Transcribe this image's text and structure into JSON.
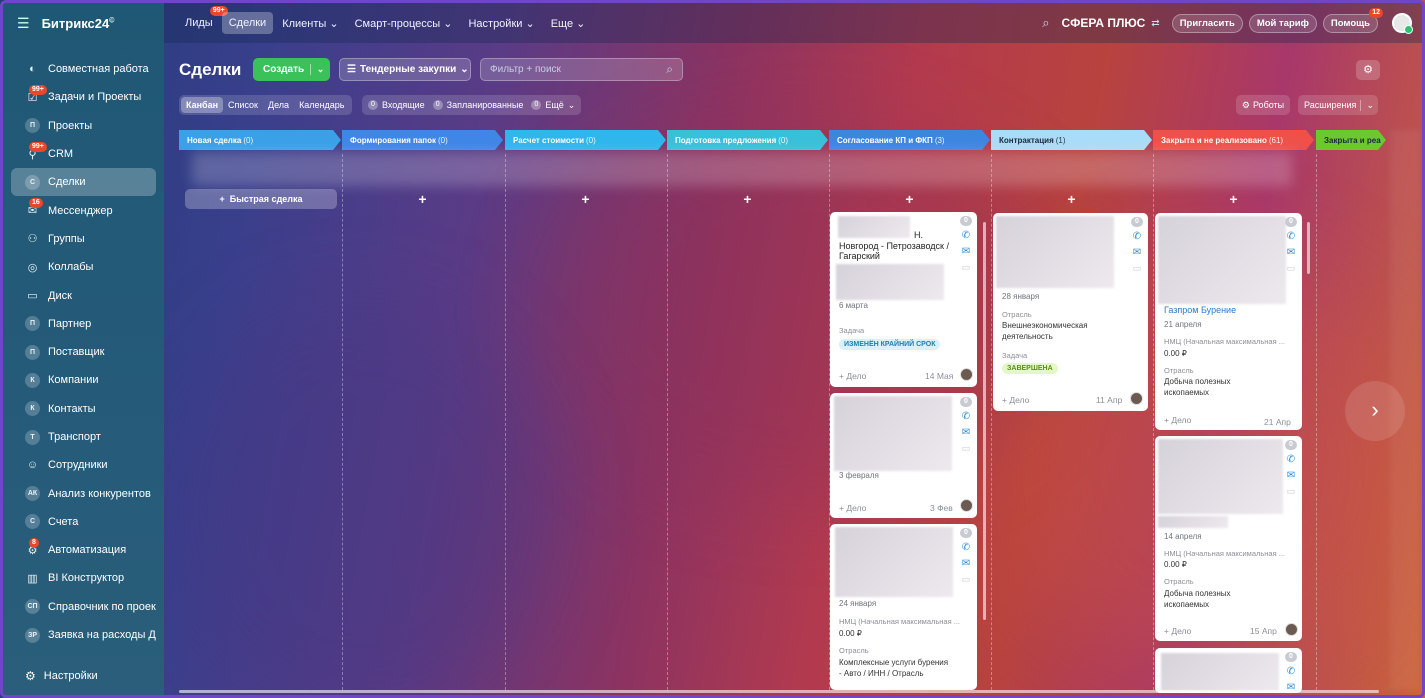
{
  "app": {
    "logo": "Битрикс24",
    "logo_mark": "©"
  },
  "sidebar": {
    "items": [
      {
        "label": "Совместная работа",
        "icon": "collab-icon",
        "badge": "",
        "chev": "⌄"
      },
      {
        "label": "Задачи и Проекты",
        "icon": "tasks-icon",
        "badge": "99+"
      },
      {
        "label": "Проекты",
        "icon": "П",
        "badge": ""
      },
      {
        "label": "CRM",
        "icon": "crm-icon",
        "badge": "99+"
      },
      {
        "label": "Сделки",
        "icon": "С",
        "badge": "",
        "active": true
      },
      {
        "label": "Мессенджер",
        "icon": "messenger-icon",
        "badge": "16"
      },
      {
        "label": "Группы",
        "icon": "groups-icon",
        "badge": ""
      },
      {
        "label": "Коллабы",
        "icon": "collabs-icon",
        "badge": ""
      },
      {
        "label": "Диск",
        "icon": "disk-icon",
        "badge": ""
      },
      {
        "label": "Партнер",
        "icon": "П",
        "badge": ""
      },
      {
        "label": "Поставщик",
        "icon": "П",
        "badge": ""
      },
      {
        "label": "Компании",
        "icon": "К",
        "badge": ""
      },
      {
        "label": "Контакты",
        "icon": "К",
        "badge": ""
      },
      {
        "label": "Транспорт",
        "icon": "Т",
        "badge": ""
      },
      {
        "label": "Сотрудники",
        "icon": "employees-icon",
        "badge": ""
      },
      {
        "label": "Анализ конкурентов",
        "icon": "АК",
        "badge": ""
      },
      {
        "label": "Счета",
        "icon": "С",
        "badge": ""
      },
      {
        "label": "Автоматизация",
        "icon": "automation-icon",
        "badge": "8"
      },
      {
        "label": "BI Конструктор",
        "icon": "bi-icon",
        "badge": ""
      },
      {
        "label": "Справочник по проек...",
        "icon": "СП",
        "badge": ""
      },
      {
        "label": "Заявка на расходы Дл...",
        "icon": "ЗР",
        "badge": ""
      }
    ],
    "settings": "Настройки"
  },
  "topnav": {
    "items": [
      {
        "label": "Лиды",
        "badge": "99+"
      },
      {
        "label": "Сделки",
        "active": true
      },
      {
        "label": "Клиенты ⌄"
      },
      {
        "label": "Смарт-процессы ⌄"
      },
      {
        "label": "Настройки ⌄"
      },
      {
        "label": "Еще ⌄"
      }
    ],
    "company": "СФЕРА ПЛЮС",
    "invite": "Пригласить",
    "tariff": "Мой тариф",
    "help": "Помощь",
    "help_badge": "12"
  },
  "toolbar": {
    "title": "Сделки",
    "create": "Создать",
    "tender": "Тендерные закупки",
    "filter_placeholder": "Фильтр + поиск"
  },
  "views": {
    "items": [
      "Канбан",
      "Список",
      "Дела",
      "Календарь"
    ],
    "active": 0
  },
  "counters": [
    {
      "n": "0",
      "label": "Входящие"
    },
    {
      "n": "0",
      "label": "Запланированные"
    },
    {
      "n": "0",
      "label": "Ещё"
    }
  ],
  "robots": "Роботы",
  "extensions": "Расширения",
  "stages": [
    {
      "name": "Новая сделка",
      "count": "(0)",
      "color": "#3aa0e8"
    },
    {
      "name": "Формирования папок",
      "count": "(0)",
      "color": "#3f86e6"
    },
    {
      "name": "Расчет стоимости",
      "count": "(0)",
      "color": "#2fb6ec"
    },
    {
      "name": "Подготовка предложения",
      "count": "(0)",
      "color": "#38c0d8"
    },
    {
      "name": "Согласование КП и ФКП",
      "count": "(3)",
      "color": "#3d86e0"
    },
    {
      "name": "Контрактация",
      "count": "(1)",
      "color": "#a9dcf6",
      "dark": true
    },
    {
      "name": "Закрыта и не реализовано",
      "count": "(61)",
      "color": "#f0504a"
    },
    {
      "name": "Закрыта и реа",
      "count": "",
      "color": "#6cc92c",
      "dark": true
    }
  ],
  "quick_deal": "Быстрая сделка",
  "cards": {
    "c1": {
      "title_tail": "Н.",
      "title2": "Новгород - Петрозаводск /",
      "title3": "Гагарский",
      "date": "6 марта",
      "task_label": "Задача",
      "tag": "ИЗМЕНЁН КРАЙНИЙ СРОК",
      "add": "+ Дело",
      "when": "14 Мая",
      "count": "0"
    },
    "c2": {
      "date": "3 февраля",
      "add": "+ Дело",
      "when": "3 Фев",
      "count": "0"
    },
    "c3": {
      "date": "24 января",
      "nmc": "НМЦ (Начальная максимальная ...",
      "price": "0.00 ₽",
      "ind_label": "Отрасль",
      "ind1": "Комплексные услуги бурения",
      "ind2": "- Авто / ИНН / Отрасль",
      "count": "0"
    },
    "c4": {
      "date": "28 января",
      "ind_label": "Отрасль",
      "ind1": "Внешнеэкономическая",
      "ind2": "деятельность",
      "task_label": "Задача",
      "tag": "ЗАВЕРШЕНА",
      "add": "+ Дело",
      "when": "11 Апр",
      "count": "0"
    },
    "c5": {
      "link": "Газпром Бурение",
      "date": "21 апреля",
      "nmc": "НМЦ (Начальная максимальная ...",
      "price": "0.00 ₽",
      "ind_label": "Отрасль",
      "ind1": "Добыча полезных",
      "ind2": "ископаемых",
      "add": "+ Дело",
      "when": "21 Апр",
      "count": "0"
    },
    "c6": {
      "date": "14 апреля",
      "nmc": "НМЦ (Начальная максимальная ...",
      "price": "0.00 ₽",
      "ind_label": "Отрасль",
      "ind1": "Добыча полезных",
      "ind2": "ископаемых",
      "add": "+ Дело",
      "when": "15 Апр",
      "count": "0"
    },
    "c7": {
      "count": "0"
    }
  }
}
